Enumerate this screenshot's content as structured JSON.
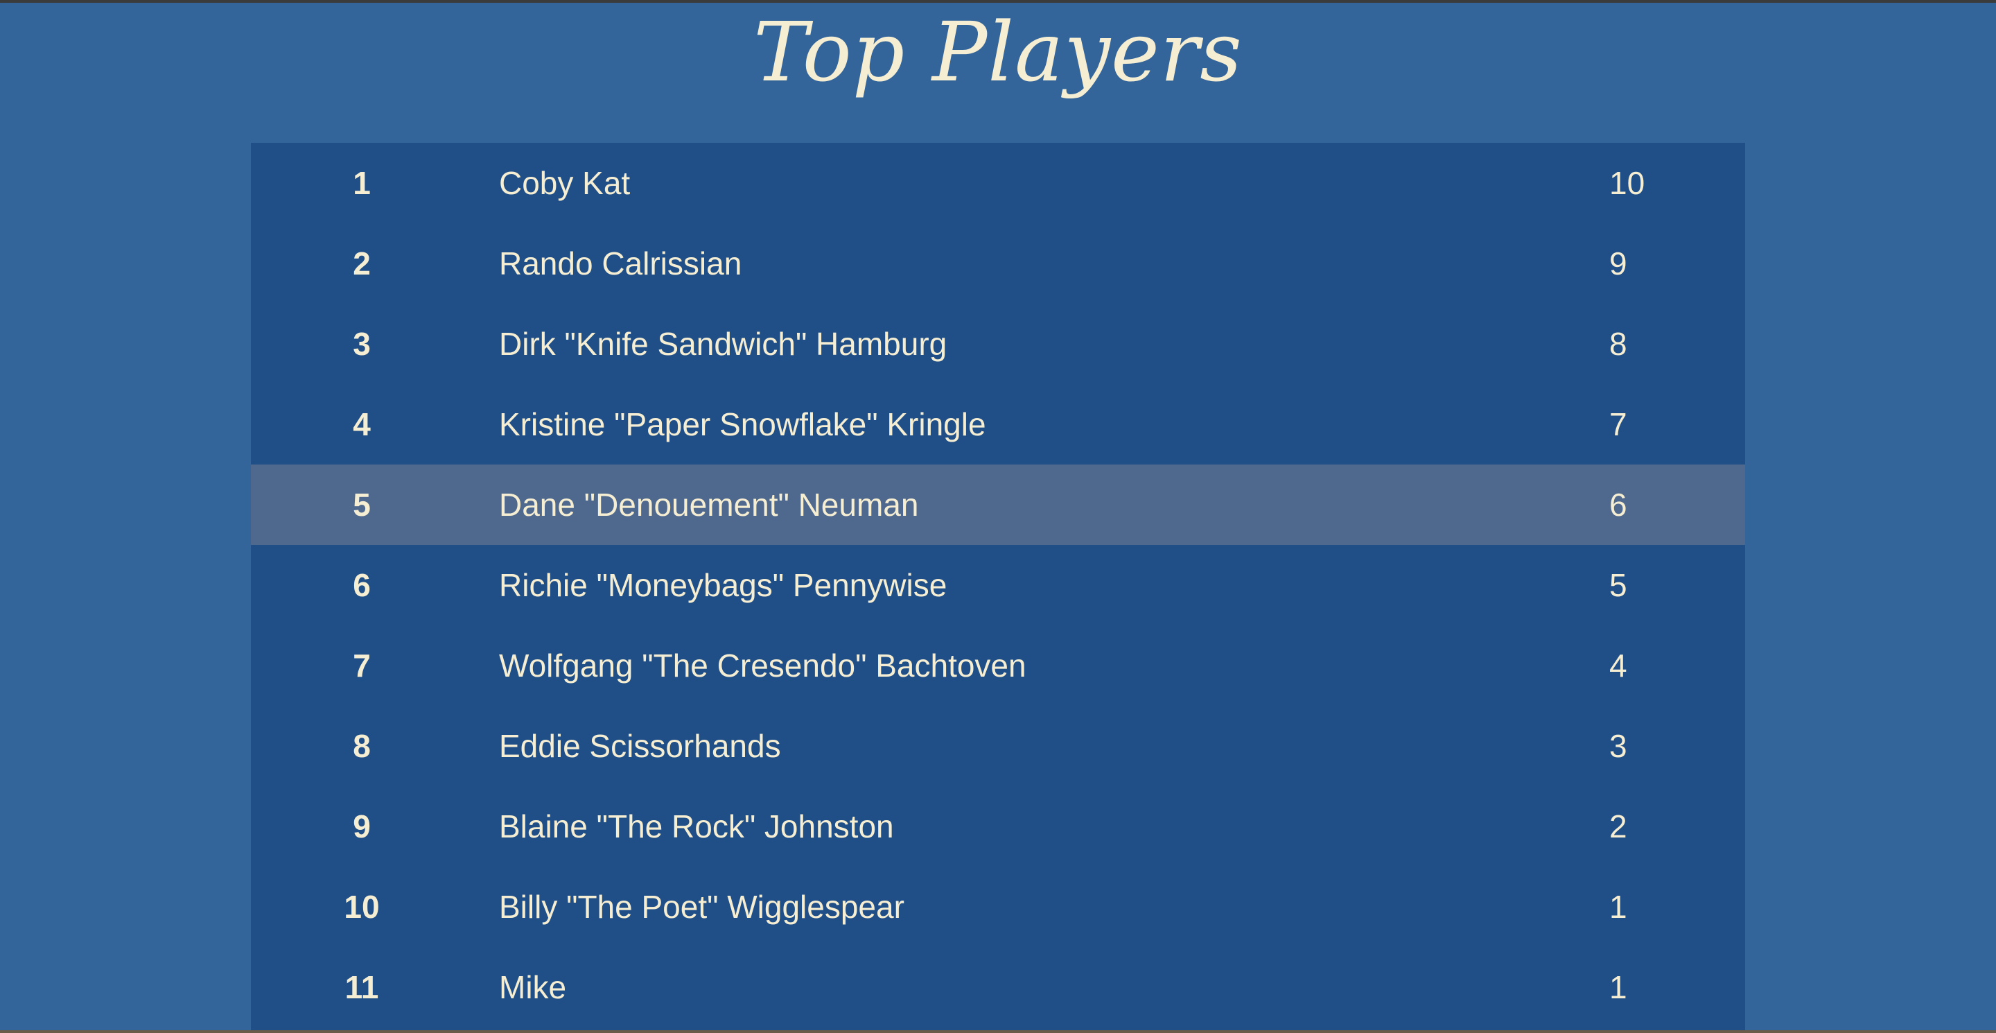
{
  "header": {
    "title": "Top Players"
  },
  "leaderboard": {
    "highlighted_rank": "5",
    "rows": [
      {
        "rank": "1",
        "name": "Coby Kat",
        "score": "10"
      },
      {
        "rank": "2",
        "name": "Rando Calrissian",
        "score": "9"
      },
      {
        "rank": "3",
        "name": "Dirk \"Knife Sandwich\" Hamburg",
        "score": "8"
      },
      {
        "rank": "4",
        "name": "Kristine \"Paper Snowflake\" Kringle",
        "score": "7"
      },
      {
        "rank": "5",
        "name": "Dane \"Denouement\" Neuman",
        "score": "6"
      },
      {
        "rank": "6",
        "name": "Richie \"Moneybags\" Pennywise",
        "score": "5"
      },
      {
        "rank": "7",
        "name": "Wolfgang \"The Cresendo\" Bachtoven",
        "score": "4"
      },
      {
        "rank": "8",
        "name": "Eddie Scissorhands",
        "score": "3"
      },
      {
        "rank": "9",
        "name": "Blaine \"The Rock\" Johnston",
        "score": "2"
      },
      {
        "rank": "10",
        "name": "Billy \"The Poet\" Wigglespear",
        "score": "1"
      },
      {
        "rank": "11",
        "name": "Mike",
        "score": "1"
      }
    ]
  },
  "colors": {
    "page_background": "#33649a",
    "table_background": "#204f88",
    "highlight_row": "#4f688e",
    "text": "#f5eed3"
  }
}
